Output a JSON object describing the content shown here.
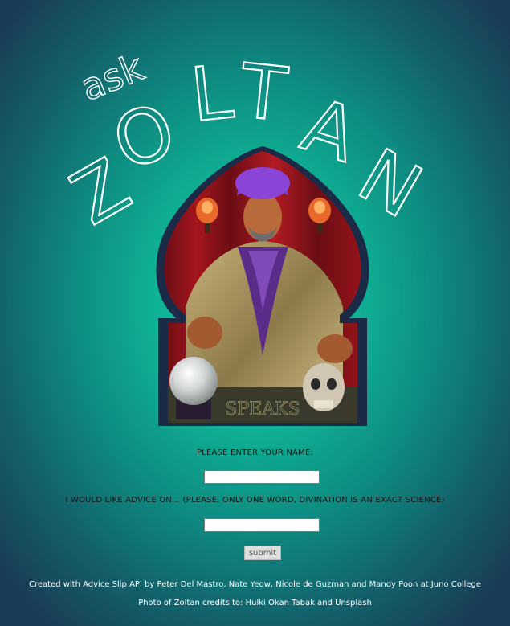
{
  "header": {
    "ask": "ask",
    "title_letters": [
      "Z",
      "O",
      "L",
      "T",
      "A",
      "N"
    ]
  },
  "portrait": {
    "banner_text": "SPEAKS"
  },
  "form": {
    "name_label": "PLEASE ENTER YOUR NAME:",
    "name_value": "",
    "advice_label": "I WOULD LIKE ADVICE ON... (PLEASE, ONLY ONE WORD, DIVINATION IS AN EXACT SCIENCE)",
    "advice_value": "",
    "submit_label": "submit"
  },
  "footer": {
    "credit_line_1": "Created with Advice Slip API by Peter Del Mastro, Nate Yeow, Nicole de Guzman and Mandy Poon at Juno College",
    "credit_line_2": "Photo of Zoltan credits to: Hulki Okan Tabak and Unsplash"
  },
  "colors": {
    "background_center": "#11d3a8",
    "background_edge": "#1a3b55",
    "frame": "#1b2a46",
    "title": "#ffffff"
  }
}
